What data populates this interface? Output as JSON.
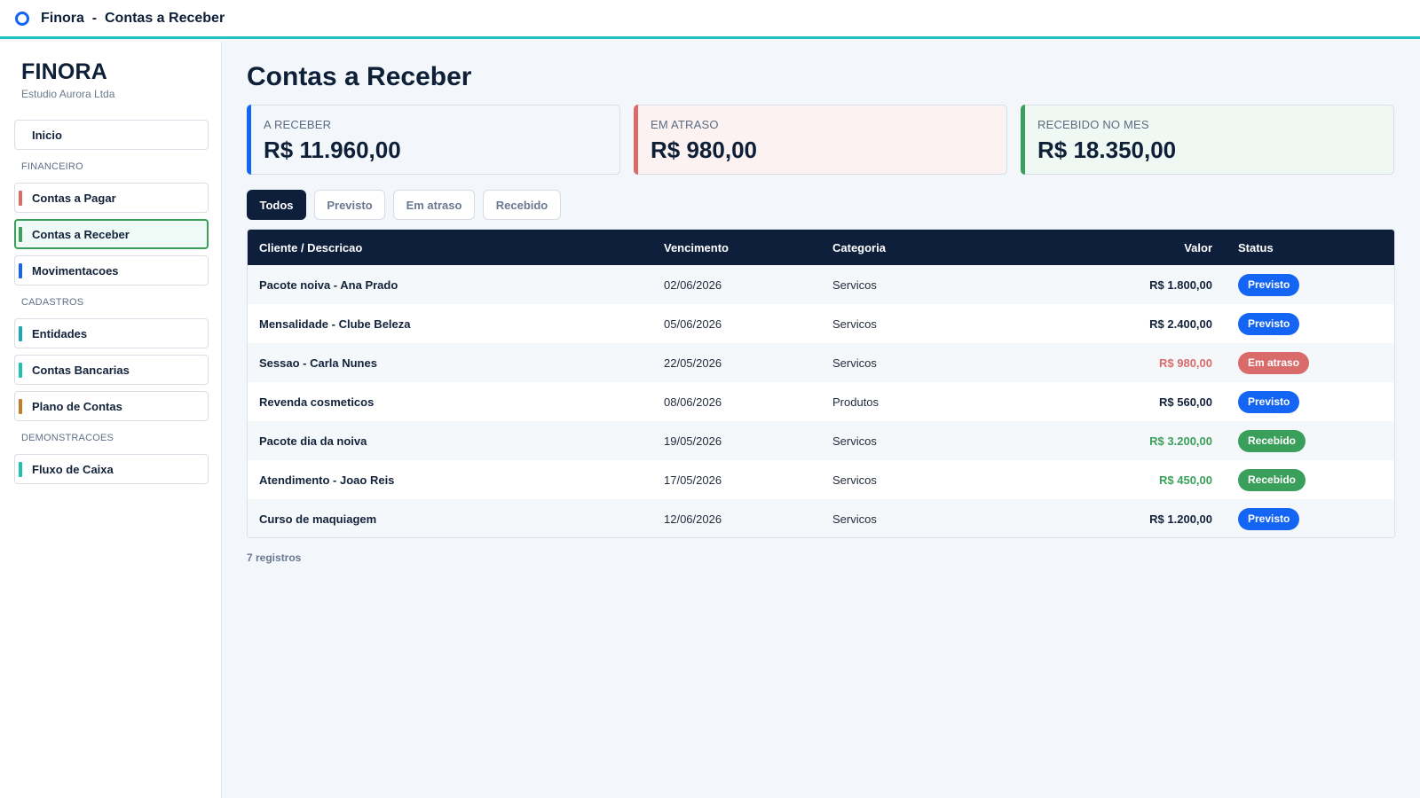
{
  "window": {
    "app_title": "Finora  -  Contas a Receber"
  },
  "brand": {
    "name": "FINORA",
    "company": "Estudio Aurora Ltda"
  },
  "sidebar": {
    "home": {
      "label": "Inicio"
    },
    "sections": [
      {
        "title": "FINANCEIRO",
        "items": [
          {
            "label": "Contas a Pagar",
            "color": "#d96b6b"
          },
          {
            "label": "Contas a Receber",
            "color": "#3a9f5a",
            "active": true
          },
          {
            "label": "Movimentacoes",
            "color": "#1565f5"
          }
        ]
      },
      {
        "title": "CADASTROS",
        "items": [
          {
            "label": "Entidades",
            "color": "#1aa7b8"
          },
          {
            "label": "Contas Bancarias",
            "color": "#1fc0b0"
          },
          {
            "label": "Plano de Contas",
            "color": "#c27c2a"
          }
        ]
      },
      {
        "title": "DEMONSTRACOES",
        "items": [
          {
            "label": "Fluxo de Caixa",
            "color": "#1fc0b0"
          }
        ]
      }
    ]
  },
  "main": {
    "title": "Contas a Receber",
    "kpis": [
      {
        "label": "A RECEBER",
        "value": "R$ 11.960,00",
        "accent": "#1565f5",
        "bg": "#f3f6fa"
      },
      {
        "label": "EM ATRASO",
        "value": "R$ 980,00",
        "accent": "#d96b6b",
        "bg": "#fdf2f2"
      },
      {
        "label": "RECEBIDO NO MES",
        "value": "R$ 18.350,00",
        "accent": "#3a9f5a",
        "bg": "#f0f8f3"
      }
    ],
    "filters": [
      {
        "label": "Todos",
        "active": true
      },
      {
        "label": "Previsto"
      },
      {
        "label": "Em atraso"
      },
      {
        "label": "Recebido"
      }
    ],
    "table": {
      "columns": [
        "Cliente / Descricao",
        "Vencimento",
        "Categoria",
        "Valor",
        "Status"
      ],
      "rows": [
        {
          "desc": "Pacote noiva - Ana Prado",
          "date": "02/06/2026",
          "category": "Servicos",
          "value": "R$ 1.800,00",
          "status": "Previsto"
        },
        {
          "desc": "Mensalidade - Clube Beleza",
          "date": "05/06/2026",
          "category": "Servicos",
          "value": "R$ 2.400,00",
          "status": "Previsto"
        },
        {
          "desc": "Sessao - Carla Nunes",
          "date": "22/05/2026",
          "category": "Servicos",
          "value": "R$ 980,00",
          "status": "Em atraso"
        },
        {
          "desc": "Revenda cosmeticos",
          "date": "08/06/2026",
          "category": "Produtos",
          "value": "R$ 560,00",
          "status": "Previsto"
        },
        {
          "desc": "Pacote dia da noiva",
          "date": "19/05/2026",
          "category": "Servicos",
          "value": "R$ 3.200,00",
          "status": "Recebido"
        },
        {
          "desc": "Atendimento - Joao Reis",
          "date": "17/05/2026",
          "category": "Servicos",
          "value": "R$ 450,00",
          "status": "Recebido"
        },
        {
          "desc": "Curso de maquiagem",
          "date": "12/06/2026",
          "category": "Servicos",
          "value": "R$ 1.200,00",
          "status": "Previsto"
        }
      ]
    },
    "footer": "7 registros"
  },
  "status_colors": {
    "Previsto": {
      "badge": "#1565f5",
      "value": "#13223a"
    },
    "Em atraso": {
      "badge": "#d96b6b",
      "value": "#d96b6b"
    },
    "Recebido": {
      "badge": "#3a9f5a",
      "value": "#3a9f5a"
    }
  }
}
